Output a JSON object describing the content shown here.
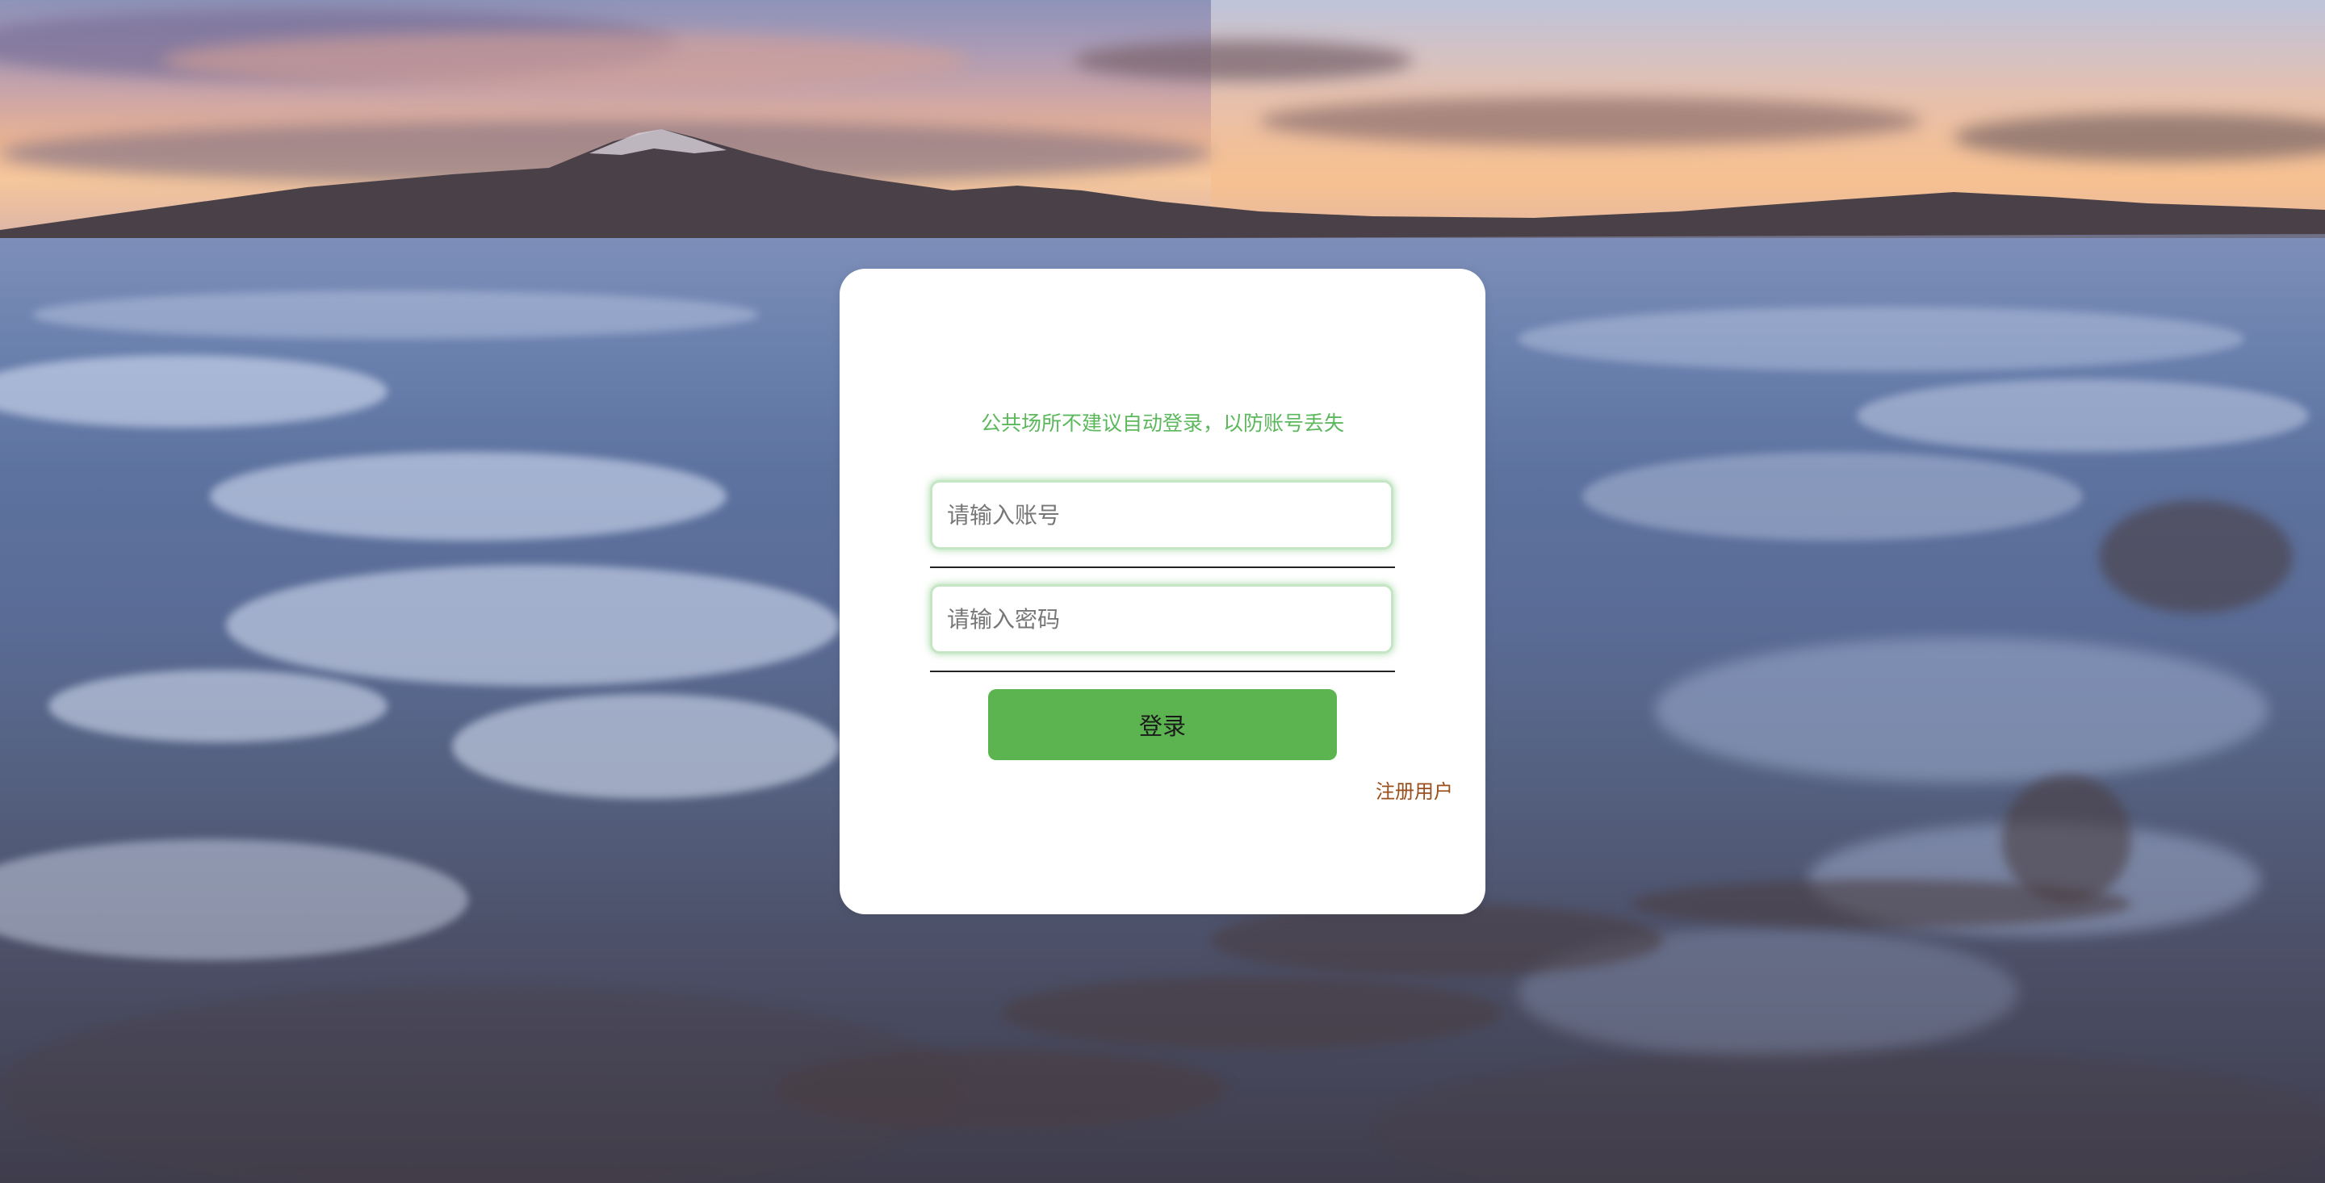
{
  "login": {
    "notice": "公共场所不建议自动登录，以防账号丢失",
    "account": {
      "placeholder": "请输入账号",
      "value": ""
    },
    "password": {
      "placeholder": "请输入密码",
      "value": ""
    },
    "submit_label": "登录",
    "register_label": "注册用户"
  },
  "theme": {
    "accent": "#5cb85c",
    "button": "#5cb450",
    "link": "#9a4f1c",
    "card": "#ffffff"
  }
}
